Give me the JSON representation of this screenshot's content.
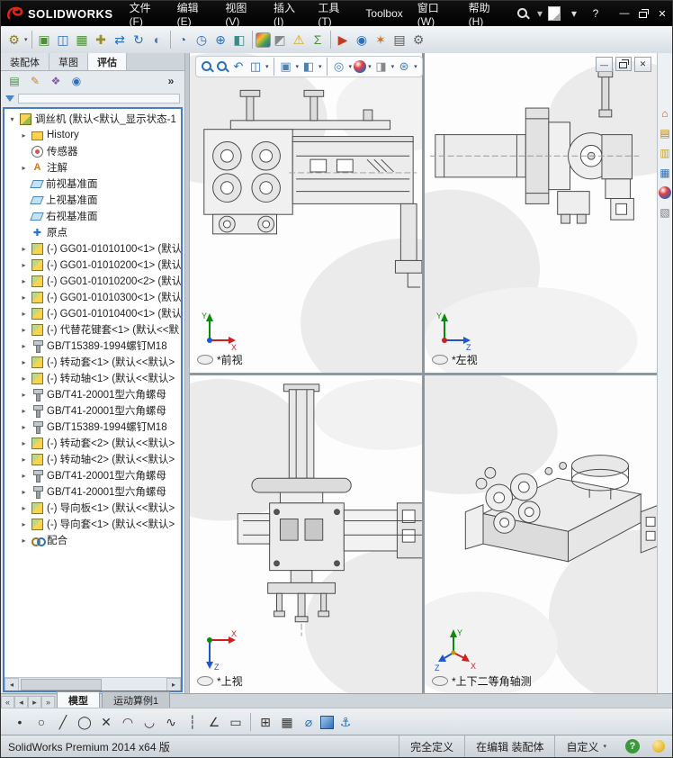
{
  "titlebar": {
    "logo_text": "SOLIDWORKS",
    "menus": [
      {
        "label": "文件(F)"
      },
      {
        "label": "编辑(E)"
      },
      {
        "label": "视图(V)"
      },
      {
        "label": "插入(I)"
      },
      {
        "label": "工具(T)"
      },
      {
        "label": "Toolbox"
      },
      {
        "label": "窗口(W)"
      },
      {
        "label": "帮助(H)"
      }
    ],
    "search_icons": [
      {
        "name": "search-icon",
        "cls": "i-mag white"
      },
      {
        "name": "search-caret-icon",
        "glyph": "▾",
        "color": "#bbbbbb"
      }
    ],
    "right_icons": [
      {
        "name": "new-document-icon",
        "cls": "page"
      },
      {
        "name": "new-document-caret-icon",
        "glyph": "▾",
        "color": "#dddddd"
      },
      {
        "name": "help-icon",
        "glyph": "?",
        "color": "#eeeeee"
      }
    ],
    "window_buttons": [
      {
        "name": "minimize-button",
        "glyph": "—",
        "color": "#ffffff"
      },
      {
        "name": "restore-button",
        "cls": "restore"
      },
      {
        "name": "close-button",
        "glyph": "✕",
        "color": "#ffffff"
      }
    ]
  },
  "toolbar": {
    "icons": [
      {
        "name": "screw-dropdown-icon",
        "glyph": "⚙",
        "color": "#8a7a22",
        "caret": true
      },
      {
        "sep": true
      },
      {
        "name": "insert-components-icon",
        "glyph": "▣",
        "color": "#4f8f3a"
      },
      {
        "name": "mate-icon",
        "glyph": "◫",
        "color": "#2f6fb7"
      },
      {
        "name": "component-pattern-icon",
        "glyph": "▦",
        "color": "#4f8f3a"
      },
      {
        "name": "smart-fasteners-icon",
        "glyph": "✚",
        "color": "#9a8a2a"
      },
      {
        "name": "move-component-icon",
        "glyph": "⇄",
        "color": "#2f6fb7"
      },
      {
        "name": "rotate-component-icon",
        "glyph": "↻",
        "color": "#2f6fb7"
      },
      {
        "name": "hide-show-components-icon",
        "glyph": "◐",
        "color": "#5a7a9a"
      },
      {
        "sep": true
      },
      {
        "name": "interference-detection-icon",
        "glyph": "◔",
        "color": "#2f6fb7"
      },
      {
        "name": "measure-icon",
        "glyph": "◷",
        "color": "#2f6fb7"
      },
      {
        "name": "mass-properties-icon",
        "glyph": "⊕",
        "color": "#2f6fb7"
      },
      {
        "name": "section-properties-icon",
        "glyph": "◧",
        "color": "#3a8a8a"
      },
      {
        "sep": true
      },
      {
        "name": "edit-appearance-icon",
        "cls": "rainbow"
      },
      {
        "name": "apply-scene-icon",
        "glyph": "◩",
        "color": "#888888"
      },
      {
        "name": "assembly-visualization-icon",
        "glyph": "⚠",
        "color": "#d9a400"
      },
      {
        "name": "equations-icon",
        "glyph": "Σ",
        "color": "#4f8f3a"
      },
      {
        "sep": true
      },
      {
        "name": "simulation-icon",
        "glyph": "▶",
        "color": "#c23b22"
      },
      {
        "name": "motion-study-icon",
        "glyph": "◉",
        "color": "#2f6fb7"
      },
      {
        "name": "exploded-view-icon",
        "glyph": "✶",
        "color": "#c2722a"
      },
      {
        "name": "bill-of-materials-icon",
        "glyph": "▤",
        "color": "#555555"
      },
      {
        "name": "options-icon",
        "glyph": "⚙",
        "color": "#666666"
      }
    ]
  },
  "commandmanager": {
    "tabs": [
      {
        "label": "装配体",
        "active": false
      },
      {
        "label": "草图",
        "active": false
      },
      {
        "label": "评估",
        "active": true
      }
    ]
  },
  "featurepanel": {
    "header_icons": [
      {
        "name": "featuremanager-tree-icon",
        "glyph": "▤",
        "color": "#3f8f3f"
      },
      {
        "name": "propertymanager-icon",
        "glyph": "✎",
        "color": "#c28a2a"
      },
      {
        "name": "configurationmanager-icon",
        "glyph": "❖",
        "color": "#8a5aaa"
      },
      {
        "name": "displaymanager-icon",
        "glyph": "◉",
        "color": "#2f6fb7"
      },
      {
        "name": "expand-pane-icon",
        "glyph": "»",
        "color": "#333333"
      }
    ],
    "tree_scrollbar": {
      "left": "◂",
      "right": "▸"
    },
    "tree": {
      "items": [
        {
          "icon": "assembly",
          "label": "调丝机 (默认<默认_显示状态-1",
          "indent": 0,
          "exp": "▾"
        },
        {
          "icon": "history",
          "label": "History",
          "indent": 1,
          "exp": "▸"
        },
        {
          "icon": "sensor",
          "label": "传感器",
          "indent": 1,
          "exp": ""
        },
        {
          "icon": "annot",
          "label": "注解",
          "indent": 1,
          "exp": "▸"
        },
        {
          "icon": "plane",
          "label": "前视基准面",
          "indent": 1,
          "exp": ""
        },
        {
          "icon": "plane",
          "label": "上视基准面",
          "indent": 1,
          "exp": ""
        },
        {
          "icon": "plane",
          "label": "右视基准面",
          "indent": 1,
          "exp": ""
        },
        {
          "icon": "origin",
          "label": "原点",
          "indent": 1,
          "exp": ""
        },
        {
          "icon": "part",
          "label": "(-) GG01-01010100<1> (默认",
          "indent": 1,
          "exp": "▸"
        },
        {
          "icon": "part",
          "label": "(-) GG01-01010200<1> (默认",
          "indent": 1,
          "exp": "▸"
        },
        {
          "icon": "part",
          "label": "(-) GG01-01010200<2> (默认",
          "indent": 1,
          "exp": "▸"
        },
        {
          "icon": "part",
          "label": "(-) GG01-01010300<1> (默认",
          "indent": 1,
          "exp": "▸"
        },
        {
          "icon": "part",
          "label": "(-) GG01-01010400<1> (默认",
          "indent": 1,
          "exp": "▸"
        },
        {
          "icon": "part",
          "label": "(-) 代替花键套<1> (默认<<默",
          "indent": 1,
          "exp": "▸"
        },
        {
          "icon": "bolt",
          "label": "GB/T15389-1994螺钉M18",
          "indent": 1,
          "exp": "▸"
        },
        {
          "icon": "part",
          "label": "(-) 转动套<1> (默认<<默认>",
          "indent": 1,
          "exp": "▸"
        },
        {
          "icon": "part",
          "label": "(-) 转动轴<1> (默认<<默认>",
          "indent": 1,
          "exp": "▸"
        },
        {
          "icon": "bolt",
          "label": "GB/T41-20001型六角螺母",
          "indent": 1,
          "exp": "▸"
        },
        {
          "icon": "bolt",
          "label": "GB/T41-20001型六角螺母",
          "indent": 1,
          "exp": "▸"
        },
        {
          "icon": "bolt",
          "label": "GB/T15389-1994螺钉M18",
          "indent": 1,
          "exp": "▸"
        },
        {
          "icon": "part",
          "label": "(-) 转动套<2> (默认<<默认>",
          "indent": 1,
          "exp": "▸"
        },
        {
          "icon": "part",
          "label": "(-) 转动轴<2> (默认<<默认>",
          "indent": 1,
          "exp": "▸"
        },
        {
          "icon": "bolt",
          "label": "GB/T41-20001型六角螺母",
          "indent": 1,
          "exp": "▸"
        },
        {
          "icon": "bolt",
          "label": "GB/T41-20001型六角螺母",
          "indent": 1,
          "exp": "▸"
        },
        {
          "icon": "part",
          "label": "(-) 导向板<1> (默认<<默认>",
          "indent": 1,
          "exp": "▸"
        },
        {
          "icon": "part",
          "label": "(-) 导向套<1> (默认<<默认>",
          "indent": 1,
          "exp": "▸"
        },
        {
          "icon": "mates",
          "label": "配合",
          "indent": 1,
          "exp": "▸"
        }
      ]
    }
  },
  "graphics": {
    "headsup": {
      "icons": [
        {
          "name": "zoom-fit-icon",
          "cls": "i-mag"
        },
        {
          "name": "zoom-area-icon",
          "cls": "i-mag"
        },
        {
          "name": "previous-view-icon",
          "glyph": "↶",
          "color": "#2f6fb7"
        },
        {
          "name": "section-view-icon",
          "glyph": "◫",
          "color": "#2f6fb7",
          "caret": true
        },
        {
          "sep": true
        },
        {
          "name": "view-orientation-icon",
          "glyph": "▣",
          "color": "#4f7faf",
          "caret": true
        },
        {
          "name": "display-style-icon",
          "glyph": "◧",
          "color": "#4f7faf",
          "caret": true
        },
        {
          "sep": true
        },
        {
          "name": "hide-show-items-icon",
          "glyph": "◎",
          "color": "#4f7faf",
          "caret": true
        },
        {
          "name": "edit-appearance-icon",
          "cls": "ball",
          "caret": true
        },
        {
          "name": "apply-scene-icon",
          "glyph": "◨",
          "color": "#888888",
          "caret": true
        },
        {
          "name": "view-settings-icon",
          "glyph": "⊛",
          "color": "#4f7faf",
          "caret": true
        }
      ]
    },
    "doc_window_buttons": [
      {
        "name": "doc-minimize-icon",
        "glyph": "—",
        "color": "#333333"
      },
      {
        "name": "doc-restore-icon",
        "cls": "restore dark"
      },
      {
        "name": "doc-close-icon",
        "glyph": "✕",
        "color": "#333333"
      }
    ],
    "viewports": [
      {
        "label": "*前视",
        "axes": [
          "Y",
          "X"
        ]
      },
      {
        "label": "*左视",
        "axes": [
          "Y",
          "Z"
        ]
      },
      {
        "label": "*上视",
        "axes": [
          "X",
          "Z"
        ]
      },
      {
        "label": "*上下二等角轴测",
        "axes": [
          "Y",
          "X",
          "Z"
        ]
      }
    ]
  },
  "taskpane": {
    "icons": [
      {
        "name": "home-icon",
        "glyph": "⌂",
        "color": "#c05a1e"
      },
      {
        "name": "design-library-icon",
        "glyph": "▤",
        "color": "#b8860b"
      },
      {
        "name": "file-explorer-icon",
        "glyph": "▥",
        "color": "#c2a32a"
      },
      {
        "name": "view-palette-icon",
        "glyph": "▦",
        "color": "#2f6fb7"
      },
      {
        "name": "appearances-icon",
        "cls": "ball"
      },
      {
        "name": "custom-properties-icon",
        "glyph": "▧",
        "color": "#777777"
      }
    ]
  },
  "bottom_tabs": {
    "nav": [
      {
        "name": "first-tab-icon",
        "glyph": "«",
        "color": "#444444"
      },
      {
        "name": "prev-tab-icon",
        "glyph": "◂",
        "color": "#444444"
      },
      {
        "name": "next-tab-icon",
        "glyph": "▸",
        "color": "#444444"
      },
      {
        "name": "last-tab-icon",
        "glyph": "»",
        "color": "#444444"
      }
    ],
    "tabs": [
      {
        "label": "模型",
        "active": true
      },
      {
        "label": "运动算例1",
        "active": false
      }
    ]
  },
  "sketchbar": {
    "icons": [
      {
        "name": "point-icon",
        "glyph": "•"
      },
      {
        "name": "circle-icon",
        "glyph": "○"
      },
      {
        "name": "line-icon",
        "glyph": "╱"
      },
      {
        "name": "perimeter-circle-icon",
        "glyph": "◯"
      },
      {
        "name": "trim-entities-icon",
        "glyph": "✕"
      },
      {
        "name": "arc-icon",
        "glyph": "◠"
      },
      {
        "name": "tangent-arc-icon",
        "glyph": "◡"
      },
      {
        "name": "spline-icon",
        "glyph": "∿"
      },
      {
        "name": "centerline-icon",
        "glyph": "┆"
      },
      {
        "name": "sketch-angle-icon",
        "glyph": "∠"
      },
      {
        "name": "corner-rectangle-icon",
        "glyph": "▭"
      },
      {
        "sep": true
      },
      {
        "name": "convert-entities-icon",
        "glyph": "⊞"
      },
      {
        "name": "linear-sketch-pattern-icon",
        "glyph": "▦"
      },
      {
        "name": "smart-dimension-icon",
        "glyph": "⌀",
        "color": "#2f6fb7"
      },
      {
        "name": "3d-sketch-icon",
        "cls": "cube"
      },
      {
        "name": "anchor-icon",
        "glyph": "⚓",
        "color": "#2f6fb7"
      }
    ]
  },
  "statusbar": {
    "app_version": "SolidWorks Premium 2014 x64 版",
    "segments": [
      {
        "name": "definition-status",
        "label": "完全定义"
      },
      {
        "name": "edit-status",
        "label": "在编辑 装配体"
      },
      {
        "name": "customize-dropdown",
        "label": "自定义",
        "caret": true
      }
    ],
    "icons": [
      {
        "name": "help-status-icon",
        "glyph": "?",
        "cls": "green-q"
      },
      {
        "name": "quick-tip-icon",
        "cls": "gold-dot"
      }
    ]
  }
}
